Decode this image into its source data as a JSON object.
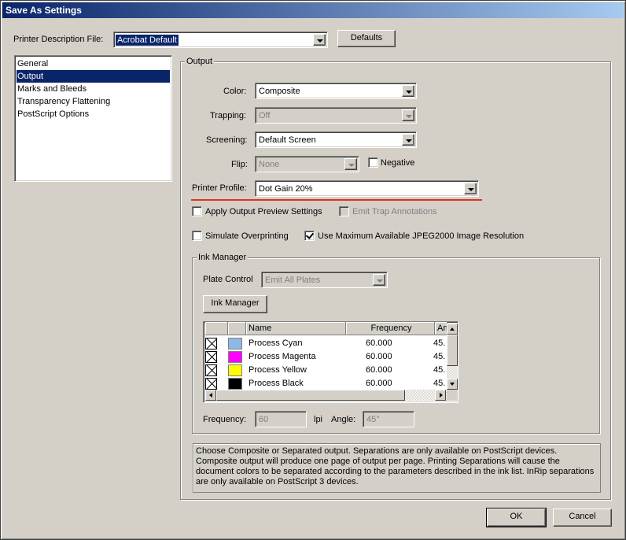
{
  "window": {
    "title": "Save As Settings"
  },
  "ppd": {
    "label": "Printer Description File:",
    "value": "Acrobat Default",
    "defaults_button": "Defaults"
  },
  "sidebar": {
    "items": [
      {
        "label": "General"
      },
      {
        "label": "Output"
      },
      {
        "label": "Marks and Bleeds"
      },
      {
        "label": "Transparency Flattening"
      },
      {
        "label": "PostScript Options"
      }
    ],
    "selected": "Output"
  },
  "output": {
    "group_title": "Output",
    "color": {
      "label": "Color:",
      "value": "Composite"
    },
    "trapping": {
      "label": "Trapping:",
      "value": "Off"
    },
    "screening": {
      "label": "Screening:",
      "value": "Default Screen"
    },
    "flip": {
      "label": "Flip:",
      "value": "None"
    },
    "negative": {
      "label": "Negative",
      "checked": false
    },
    "printer_profile": {
      "label": "Printer Profile:",
      "value": "Dot Gain 20%"
    },
    "apply_output_preview": {
      "label": "Apply Output Preview Settings",
      "checked": false
    },
    "emit_trap_annotations": {
      "label": "Emit Trap Annotations",
      "checked": false
    },
    "simulate_overprinting": {
      "label": "Simulate Overprinting",
      "checked": false
    },
    "use_max_jpeg2000": {
      "label": "Use Maximum Available JPEG2000 Image Resolution",
      "checked": true
    }
  },
  "ink_manager": {
    "group_title": "Ink Manager",
    "plate_control": {
      "label": "Plate Control",
      "value": "Emit All Plates"
    },
    "button": "Ink Manager",
    "columns": [
      "Name",
      "Frequency",
      "An"
    ],
    "inks": [
      {
        "name": "Process Cyan",
        "frequency": "60.000",
        "angle": "45.",
        "color": "#8fb8e8"
      },
      {
        "name": "Process Magenta",
        "frequency": "60.000",
        "angle": "45.",
        "color": "#ff00ff"
      },
      {
        "name": "Process Yellow",
        "frequency": "60.000",
        "angle": "45.",
        "color": "#ffff00"
      },
      {
        "name": "Process Black",
        "frequency": "60.000",
        "angle": "45.",
        "color": "#000000"
      }
    ],
    "frequency": {
      "label": "Frequency:",
      "value": "60",
      "unit": "lpi"
    },
    "angle": {
      "label": "Angle:",
      "value": "45°"
    }
  },
  "description": "Choose Composite or Separated output. Separations are only available on PostScript devices. Composite output will produce one page of output per page. Printing Separations will cause the document colors to be separated according to the parameters described in the ink list. InRip separations are only available on PostScript 3 devices.",
  "footer": {
    "ok": "OK",
    "cancel": "Cancel"
  }
}
